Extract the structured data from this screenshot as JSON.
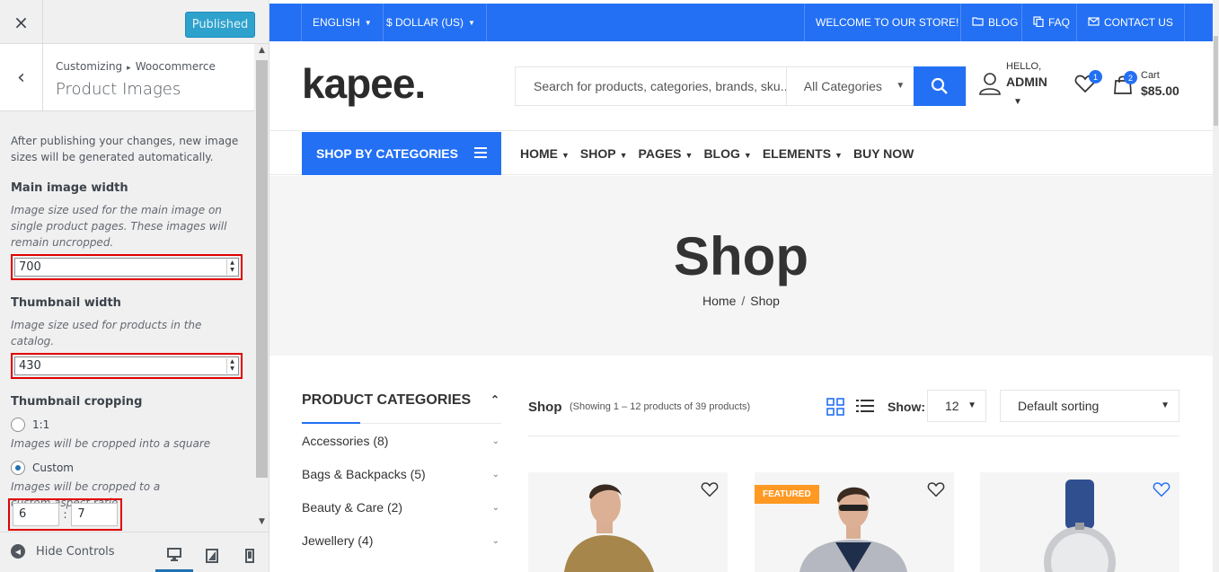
{
  "customizer": {
    "close_label": "×",
    "publish_label": "Published",
    "back_label": "‹",
    "breadcrumb": [
      "Customizing",
      "Woocommerce"
    ],
    "breadcrumb_sep": "▸",
    "section_title": "Product Images",
    "note": "After publishing your changes, new image sizes will be generated automatically.",
    "main_width": {
      "title": "Main image width",
      "desc": "Image size used for the main image on single product pages. These images will remain uncropped.",
      "value": "700"
    },
    "thumb_width": {
      "title": "Thumbnail width",
      "desc": "Image size used for products in the catalog.",
      "value": "430"
    },
    "cropping": {
      "title": "Thumbnail cropping",
      "options": [
        {
          "label": "1:1",
          "desc": "Images will be cropped into a square",
          "checked": false
        },
        {
          "label": "Custom",
          "desc": "Images will be cropped to a custom aspect ratio",
          "checked": true
        }
      ],
      "ratio_w": "6",
      "ratio_sep": ":",
      "ratio_h": "7"
    },
    "hide_controls_label": "Hide Controls",
    "devices": [
      "desktop-icon",
      "tablet-icon",
      "mobile-icon"
    ]
  },
  "store": {
    "topbar": {
      "language": "ENGLISH",
      "currency": "$ DOLLAR (US)",
      "welcome": "WELCOME TO OUR STORE!",
      "blog": "BLOG",
      "faq": "FAQ",
      "contact": "CONTACT US"
    },
    "logo": "kapee.",
    "search": {
      "placeholder": "Search for products, categories, brands, sku..",
      "category": "All Categories"
    },
    "user": {
      "hello": "HELLO,",
      "name": "ADMIN"
    },
    "wishlist_count": "1",
    "cart": {
      "count": "2",
      "label": "Cart",
      "amount": "$85.00"
    },
    "nav": {
      "categories_button": "SHOP BY CATEGORIES",
      "menu": [
        "HOME",
        "SHOP",
        "PAGES",
        "BLOG",
        "ELEMENTS",
        "BUY NOW"
      ]
    },
    "hero": {
      "title": "Shop",
      "crumb_home": "Home",
      "crumb_sep": "/",
      "crumb_current": "Shop"
    },
    "product_categories": {
      "title": "PRODUCT CATEGORIES",
      "items": [
        "Accessories (8)",
        "Bags & Backpacks (5)",
        "Beauty & Care (2)",
        "Jewellery (4)"
      ]
    },
    "toolbar": {
      "shop_label": "Shop",
      "count_text": "(Showing 1 – 12 products of 39 products)",
      "show_label": "Show:",
      "show_value": "12",
      "sort_value": "Default sorting"
    },
    "featured_badge": "FEATURED",
    "colors": {
      "accent": "#2370f4",
      "featured": "#ff9923",
      "highlight": "#e00000"
    }
  }
}
